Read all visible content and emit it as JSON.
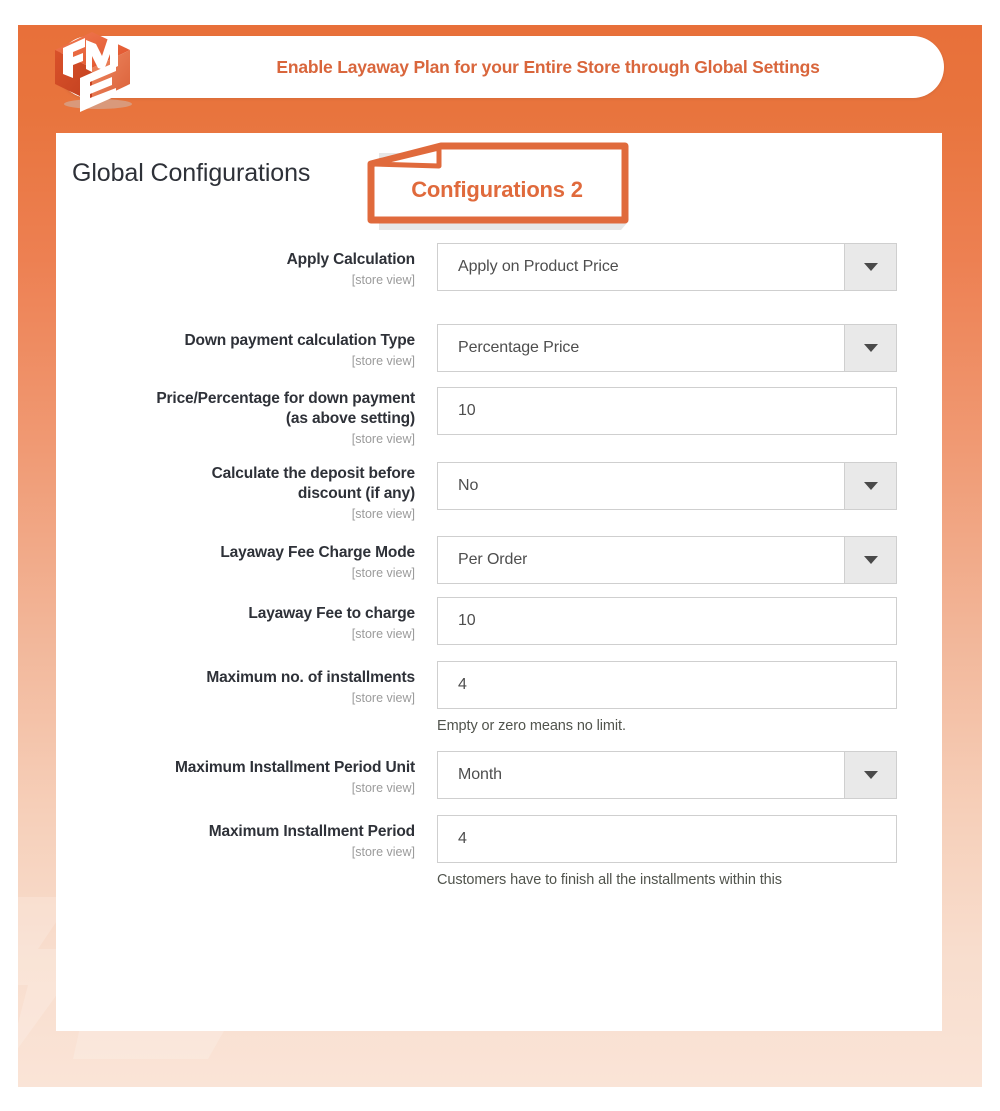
{
  "brand": {
    "logo_icon": "fme-cube-logo",
    "accent_color": "#e06a3c",
    "header_text_color": "#d9663c",
    "background_gradient_top": "#e8703a",
    "background_gradient_bottom": "#fae4d7"
  },
  "header": {
    "title": "Enable Layaway Plan for your Entire Store through Global Settings"
  },
  "panel": {
    "title": "Global Configurations",
    "badge": {
      "label": "Configurations 2",
      "icon": "folded-tag-icon"
    }
  },
  "scope_label": "[store view]",
  "dropdown_icon": "chevron-down-icon",
  "form": {
    "rows": [
      {
        "label": "Apply Calculation",
        "scope": "[store view]",
        "type": "select",
        "value": "Apply on Product Price",
        "hint": ""
      },
      {
        "label": "Down payment calculation Type",
        "scope": "[store view]",
        "type": "select",
        "value": "Percentage Price",
        "hint": ""
      },
      {
        "label": "Price/Percentage for down payment (as above setting)",
        "label_line1": "Price/Percentage for down payment",
        "label_line2": "(as above setting)",
        "scope": "[store view]",
        "type": "text",
        "value": "10",
        "hint": ""
      },
      {
        "label": "Calculate the deposit before discount (if any)",
        "label_line1": "Calculate the deposit before",
        "label_line2": "discount (if any)",
        "scope": "[store view]",
        "type": "select",
        "value": "No",
        "hint": ""
      },
      {
        "label": "Layaway Fee Charge Mode",
        "scope": "[store view]",
        "type": "select",
        "value": "Per Order",
        "hint": ""
      },
      {
        "label": "Layaway Fee to charge",
        "scope": "[store view]",
        "type": "text",
        "value": "10",
        "hint": ""
      },
      {
        "label": "Maximum no. of installments",
        "scope": "[store view]",
        "type": "text",
        "value": "4",
        "hint": "Empty or zero means no limit."
      },
      {
        "label": "Maximum Installment Period Unit",
        "scope": "[store view]",
        "type": "select",
        "value": "Month",
        "hint": ""
      },
      {
        "label": "Maximum Installment Period",
        "scope": "[store view]",
        "type": "text",
        "value": "4",
        "hint": "Customers have to finish all the installments within this"
      }
    ]
  }
}
